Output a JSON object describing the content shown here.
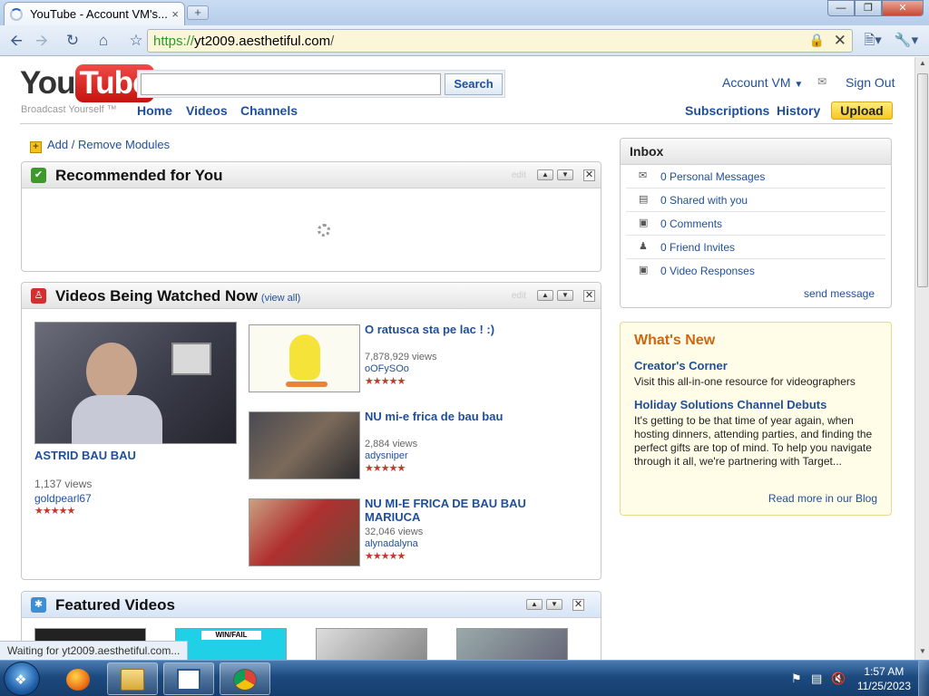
{
  "browser": {
    "tab_title": "YouTube - Account VM's...",
    "tab_close": "×",
    "new_tab": "+",
    "url_scheme": "https://",
    "url_host": "yt2009.aesthetiful.com",
    "url_path": "/",
    "status_text": "Waiting for yt2009.aesthetiful.com..."
  },
  "header": {
    "logo_you": "You",
    "logo_tube": "Tube",
    "slogan": "Broadcast Yourself ™",
    "search_value": "",
    "search_button": "Search",
    "nav": [
      "Home",
      "Videos",
      "Channels"
    ],
    "account": "Account VM",
    "sign_out": "Sign Out",
    "subscriptions": "Subscriptions",
    "history": "History",
    "upload": "Upload"
  },
  "add_modules": "Add / Remove Modules",
  "modules": {
    "recommended": {
      "title": "Recommended for You",
      "edit": "edit"
    },
    "watched": {
      "title": "Videos Being Watched Now",
      "view_all": "(view all)",
      "edit": "edit",
      "featured_video": {
        "title": "ASTRID BAU BAU",
        "views": "1,137 views",
        "user": "goldpearl67",
        "rating": "★★★★★"
      },
      "videos": [
        {
          "title": "O ratusca sta pe lac ! :)",
          "views": "7,878,929 views",
          "user": "oOFySOo",
          "rating": "★★★★★"
        },
        {
          "title": "NU mi-e frica de bau bau",
          "views": "2,884 views",
          "user": "adysniper",
          "rating": "★★★★★"
        },
        {
          "title": "NU MI-E FRICA DE BAU BAU MARIUCA",
          "views": "32,046 views",
          "user": "alynadalyna",
          "rating": "★★★★★"
        }
      ]
    },
    "featured": {
      "title": "Featured Videos",
      "thumb2_label": "WIN/FAIL"
    }
  },
  "inbox": {
    "title": "Inbox",
    "items": [
      {
        "label": "0 Personal Messages",
        "icon": "envelope-icon"
      },
      {
        "label": "0 Shared with you",
        "icon": "shared-icon"
      },
      {
        "label": "0 Comments",
        "icon": "comment-icon"
      },
      {
        "label": "0 Friend Invites",
        "icon": "person-icon"
      },
      {
        "label": "0 Video Responses",
        "icon": "video-response-icon"
      }
    ],
    "send_message": "send message"
  },
  "whats_new": {
    "title": "What's New",
    "item1_title": "Creator's Corner",
    "item1_text": "Visit this all-in-one resource for videographers",
    "item2_title": "Holiday Solutions Channel Debuts",
    "item2_text": "It's getting to be that time of year again, when hosting dinners, attending parties, and finding the perfect gifts are top of mind. To help you navigate through it all, we're partnering with Target...",
    "read_more": "Read more in our Blog"
  },
  "taskbar": {
    "time": "1:57 AM",
    "date": "11/25/2023"
  },
  "colors": {
    "link": "#1f4f9b",
    "accent_orange": "#d1650e",
    "upload_yellow": "#f6c722",
    "star_red": "#c0392b"
  }
}
